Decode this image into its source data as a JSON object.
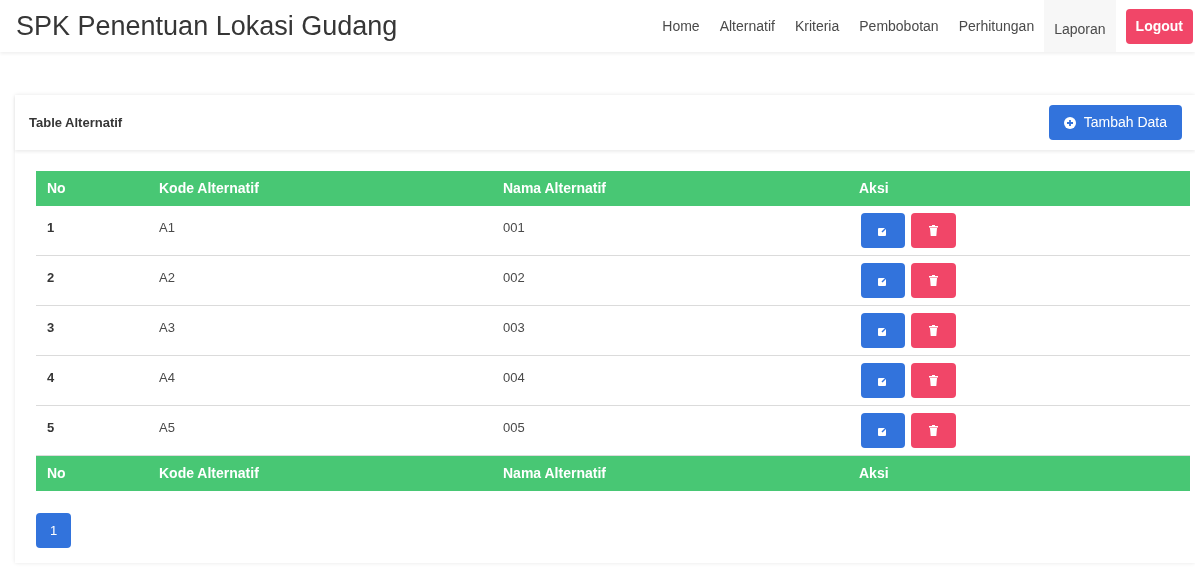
{
  "brand": "SPK Penentuan Lokasi Gudang",
  "nav": [
    {
      "label": "Home",
      "selected": false
    },
    {
      "label": "Alternatif",
      "selected": false
    },
    {
      "label": "Kriteria",
      "selected": false
    },
    {
      "label": "Pembobotan",
      "selected": false
    },
    {
      "label": "Perhitungan",
      "selected": false
    },
    {
      "label": "Laporan",
      "selected": true
    }
  ],
  "logout": "Logout",
  "card": {
    "title": "Table Alternatif",
    "add_button": "Tambah Data"
  },
  "table": {
    "columns": [
      "No",
      "Kode Alternatif",
      "Nama Alternatif",
      "Aksi"
    ],
    "rows": [
      {
        "no": "1",
        "kode": "A1",
        "nama": "001"
      },
      {
        "no": "2",
        "kode": "A2",
        "nama": "002"
      },
      {
        "no": "3",
        "kode": "A3",
        "nama": "003"
      },
      {
        "no": "4",
        "kode": "A4",
        "nama": "004"
      },
      {
        "no": "5",
        "kode": "A5",
        "nama": "005"
      }
    ],
    "footer_columns": [
      "No",
      "Kode Alternatif",
      "Nama Alternatif",
      "Aksi"
    ]
  },
  "pagination": [
    {
      "label": "1",
      "selected": true
    }
  ]
}
